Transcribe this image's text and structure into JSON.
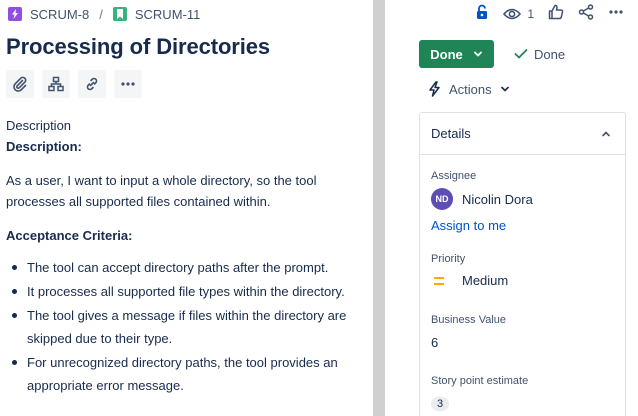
{
  "breadcrumb": {
    "epic_key": "SCRUM-8",
    "separator": "/",
    "issue_key": "SCRUM-11",
    "epic_icon": "lightning-icon",
    "story_icon": "bookmark-icon"
  },
  "issue": {
    "title": "Processing of Directories"
  },
  "toolbar": {
    "icons": [
      "paperclip-icon",
      "child-issues-icon",
      "link-icon",
      "more-icon"
    ]
  },
  "description": {
    "label": "Description",
    "heading": "Description:",
    "paragraph": "As a user, I want to input a whole directory, so the tool processes all supported files contained within.",
    "ac_heading": "Acceptance Criteria:",
    "criteria": [
      "The tool can accept directory paths after the prompt.",
      "It processes all supported file types within the directory.",
      "The tool gives a message if files within the directory are skipped due to their type.",
      "For unrecognized directory paths, the tool provides an appropriate error message."
    ]
  },
  "top_actions": {
    "watch_count": "1"
  },
  "status": {
    "button_label": "Done",
    "resolution_label": "Done"
  },
  "actions": {
    "label": "Actions"
  },
  "details": {
    "header": "Details",
    "assignee_label": "Assignee",
    "assignee_initials": "ND",
    "assignee_name": "Nicolin Dora",
    "assign_to_me": "Assign to me",
    "priority_label": "Priority",
    "priority_value": "Medium",
    "business_value_label": "Business Value",
    "business_value": "6",
    "story_points_label": "Story point estimate",
    "story_points": "3"
  },
  "colors": {
    "done_green": "#1f8456",
    "link_blue": "#0052cc",
    "epic_purple": "#904ee2",
    "story_green": "#36b37e",
    "avatar_purple": "#5e4db2",
    "priority_medium": "#ffab00",
    "lock_blue": "#0052cc"
  }
}
